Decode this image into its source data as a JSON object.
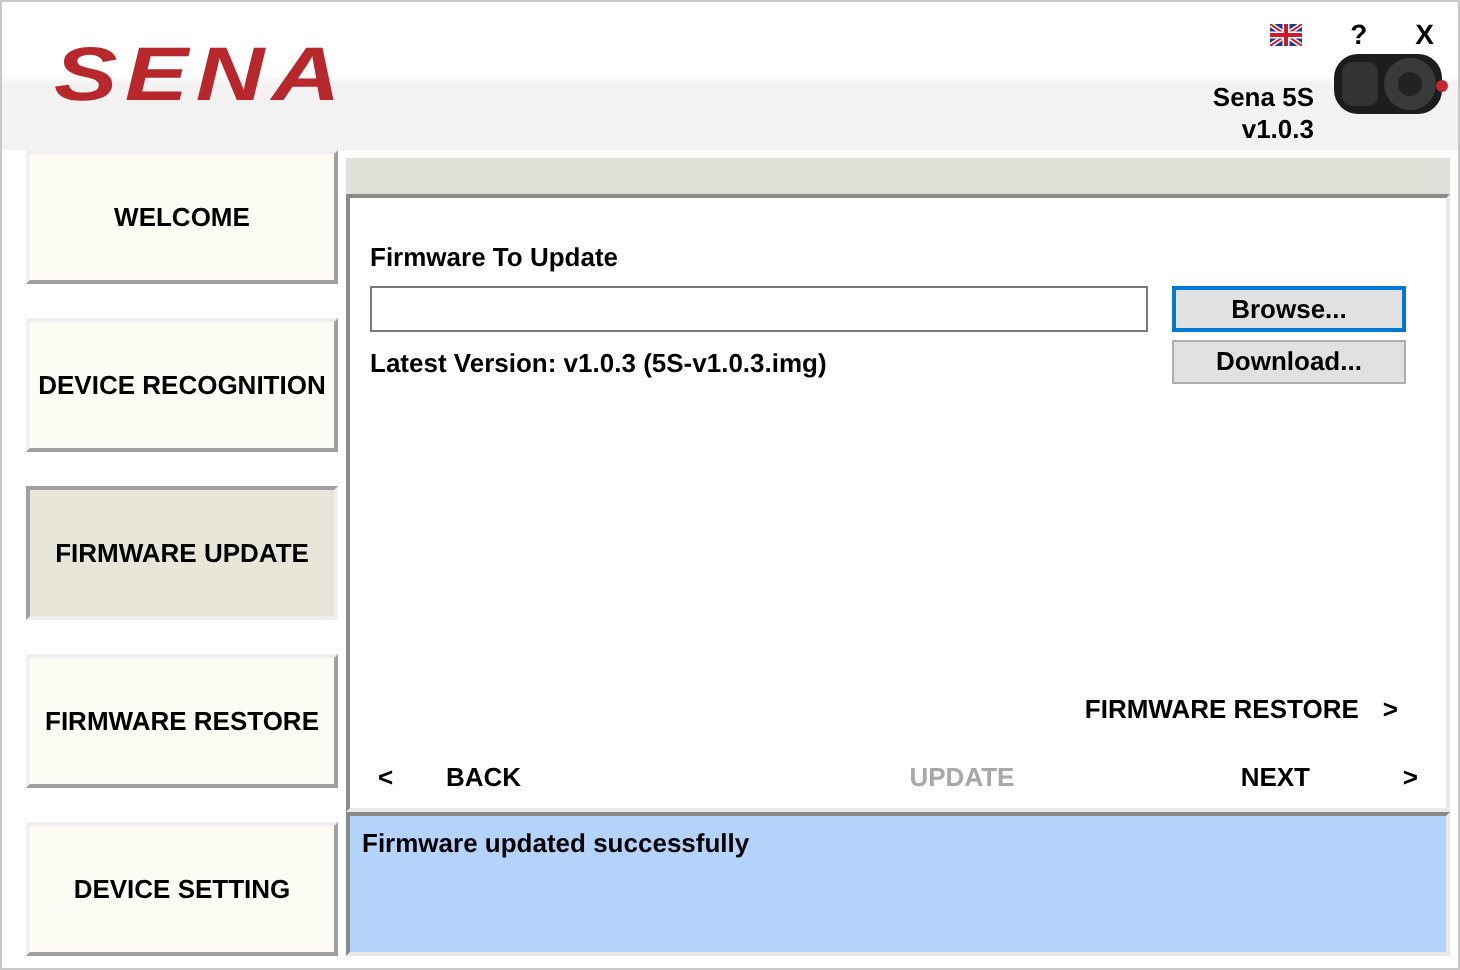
{
  "header": {
    "logo": "SENA",
    "help": "?",
    "close": "X",
    "device_name": "Sena 5S",
    "device_version": "v1.0.3"
  },
  "sidebar": {
    "items": [
      {
        "label": "WELCOME",
        "selected": false
      },
      {
        "label": "DEVICE RECOGNITION",
        "selected": false
      },
      {
        "label": "FIRMWARE UPDATE",
        "selected": true
      },
      {
        "label": "FIRMWARE RESTORE",
        "selected": false
      },
      {
        "label": "DEVICE SETTING",
        "selected": false
      }
    ]
  },
  "form": {
    "label": "Firmware To Update",
    "browse": "Browse...",
    "download": "Download...",
    "latest": "Latest Version: v1.0.3 (5S-v1.0.3.img)"
  },
  "restore_link": {
    "label": "FIRMWARE RESTORE",
    "arrow": ">"
  },
  "nav": [
    {
      "label": "<",
      "disabled": false
    },
    {
      "label": "BACK",
      "disabled": false
    },
    {
      "label": "UPDATE",
      "disabled": true
    },
    {
      "label": "NEXT",
      "disabled": false
    },
    {
      "label": ">",
      "disabled": false
    }
  ],
  "status": "Firmware updated successfully"
}
